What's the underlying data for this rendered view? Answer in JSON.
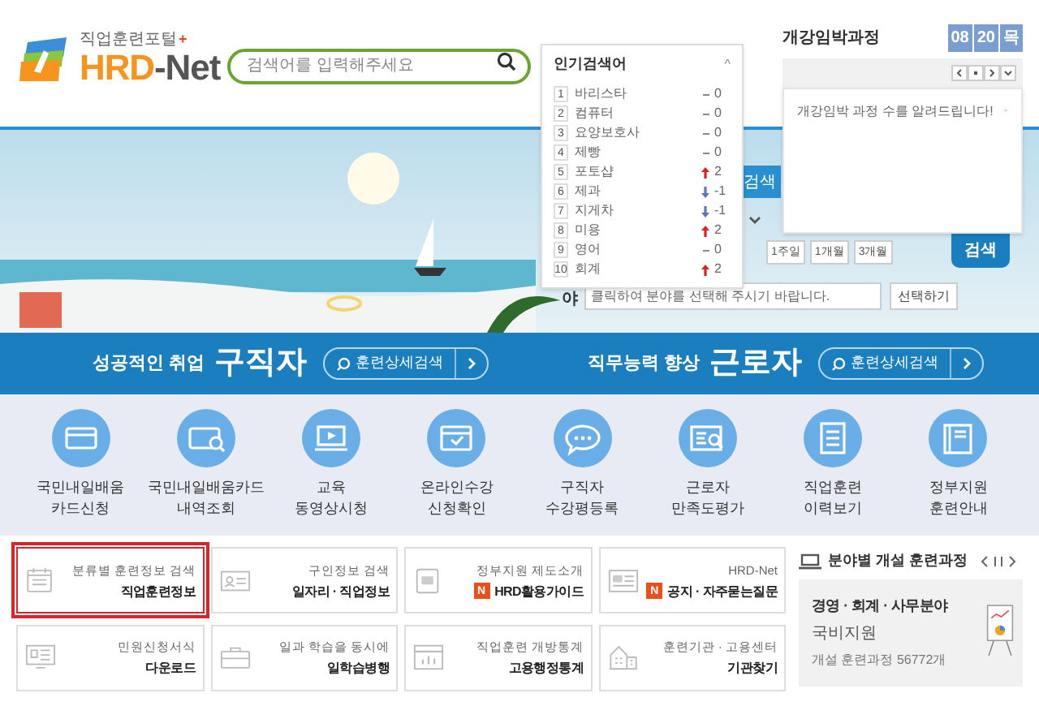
{
  "logo": {
    "tagline": "직업훈련포털",
    "name_part_1": "HRD",
    "name_part_2": "-Net",
    "plus": "+"
  },
  "search": {
    "placeholder": "검색어를 입력해주세요"
  },
  "popular_keywords": {
    "title": "인기검색어",
    "toggle": "^",
    "items": [
      {
        "rank": "1",
        "term": "바리스타",
        "kind": "same",
        "change": "0"
      },
      {
        "rank": "2",
        "term": "컴퓨터",
        "kind": "same",
        "change": "0"
      },
      {
        "rank": "3",
        "term": "요양보호사",
        "kind": "same",
        "change": "0"
      },
      {
        "rank": "4",
        "term": "제빵",
        "kind": "same",
        "change": "0"
      },
      {
        "rank": "5",
        "term": "포토샵",
        "kind": "up",
        "change": "2"
      },
      {
        "rank": "6",
        "term": "제과",
        "kind": "down",
        "change": "-1"
      },
      {
        "rank": "7",
        "term": "지게차",
        "kind": "down",
        "change": "-1"
      },
      {
        "rank": "8",
        "term": "미용",
        "kind": "up",
        "change": "2"
      },
      {
        "rank": "9",
        "term": "영어",
        "kind": "same",
        "change": "0"
      },
      {
        "rank": "10",
        "term": "회계",
        "kind": "up",
        "change": "2"
      }
    ]
  },
  "upcoming_courses": {
    "title": "개강임박과정",
    "date": [
      "08",
      "20",
      "목"
    ],
    "message": "개강임박 과정 수를 알려드립니다!"
  },
  "search_form": {
    "labels": [
      "야"
    ],
    "tab": "검색",
    "periods": [
      "1주일",
      "1개월",
      "3개월"
    ],
    "field_placeholder": "클릭하여 분야를 선택해 주시기 바랍니다.",
    "select_button": "선택하기",
    "search_button": "검색"
  },
  "audience_bar": [
    {
      "subtitle": "성공적인 취업",
      "title": "구직자",
      "button": "훈련상세검색"
    },
    {
      "subtitle": "직무능력 향상",
      "title": "근로자",
      "button": "훈련상세검색"
    }
  ],
  "quick_menu": [
    {
      "line_1": "국민내일배움",
      "line_2": "카드신청"
    },
    {
      "line_1": "국민내일배움카드",
      "line_2": "내역조회"
    },
    {
      "line_1": "교육",
      "line_2": "동영상시청"
    },
    {
      "line_1": "온라인수강",
      "line_2": "신청확인"
    },
    {
      "line_1": "구직자",
      "line_2": "수강평등록"
    },
    {
      "line_1": "근로자",
      "line_2": "만족도평가"
    },
    {
      "line_1": "직업훈련",
      "line_2": "이력보기"
    },
    {
      "line_1": "정부지원",
      "line_2": "훈련안내"
    }
  ],
  "service_cards": [
    {
      "caption": "분류별 훈련정보 검색",
      "title": "직업훈련정보",
      "selected": true
    },
    {
      "caption": "구인정보 검색",
      "title": "일자리 · 직업정보",
      "selected": false
    },
    {
      "caption": "정부지원 제도소개",
      "title": "HRD활용가이드",
      "badge": "N",
      "selected": false
    },
    {
      "caption": "HRD-Net",
      "title": "공지 · 자주묻는질문",
      "badge": "N",
      "selected": false
    },
    {
      "caption": "민원신청서식",
      "title": "다운로드",
      "selected": false
    },
    {
      "caption": "일과 학습을 동시에",
      "title": "일학습병행",
      "selected": false
    },
    {
      "caption": "직업훈련 개방통계",
      "title": "고용행정통계",
      "selected": false
    },
    {
      "caption": "훈련기관 · 고용센터",
      "title": "기관찾기",
      "selected": false
    }
  ],
  "field_courses": {
    "title": "분야별 개설 훈련과정",
    "field": "경영 · 회계 · 사무분야",
    "support": "국비지원",
    "count": "개설 훈련과정 56772개"
  }
}
